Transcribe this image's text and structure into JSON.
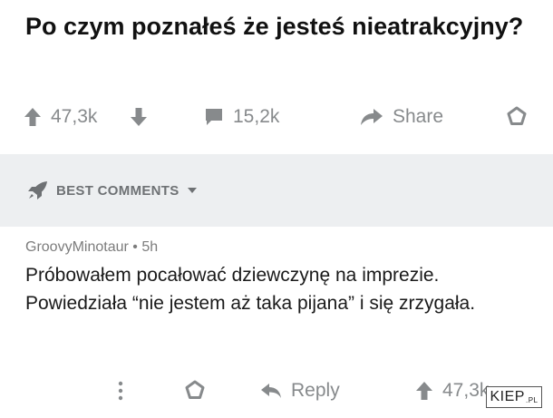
{
  "post": {
    "title": "Po czym poznałeś że jesteś nieatrakcyjny?",
    "upvotes": "47,3k",
    "comments": "15,2k",
    "share_label": "Share"
  },
  "sort": {
    "label": "BEST COMMENTS"
  },
  "comment": {
    "author": "GroovyMinotaur",
    "separator": "•",
    "age": "5h",
    "body": "Próbowałem pocałować dziewczynę na imprezie. Powiedziała “nie jestem aż taka pijana” i się zrzygała.",
    "reply_label": "Reply",
    "upvotes": "47,3k"
  },
  "watermark": {
    "text": "KIEP",
    "suffix": ".PL"
  },
  "colors": {
    "icon_gray": "#878a8c",
    "band_gray": "#edeff1"
  }
}
